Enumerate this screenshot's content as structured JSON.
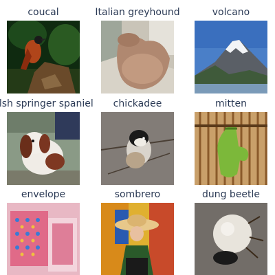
{
  "grid": {
    "items": [
      {
        "label": "coucal"
      },
      {
        "label": "Italian greyhound"
      },
      {
        "label": "volcano"
      },
      {
        "label": "elsh springer spaniel"
      },
      {
        "label": "chickadee"
      },
      {
        "label": "mitten"
      },
      {
        "label": "envelope"
      },
      {
        "label": "sombrero"
      },
      {
        "label": "dung beetle"
      }
    ]
  },
  "colors": {
    "label_text": "#2b3a55",
    "background": "#ffffff"
  }
}
